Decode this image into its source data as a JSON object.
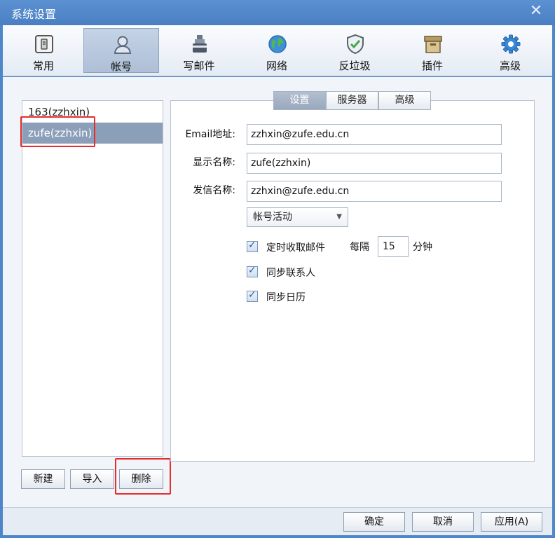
{
  "window": {
    "title": "系统设置",
    "close_glyph": "✕"
  },
  "toolbar": {
    "items": [
      {
        "label": "常用",
        "icon": "switch-icon"
      },
      {
        "label": "帐号",
        "icon": "user-icon"
      },
      {
        "label": "写邮件",
        "icon": "ink-bottle-icon"
      },
      {
        "label": "网络",
        "icon": "globe-icon"
      },
      {
        "label": "反垃圾",
        "icon": "shield-check-icon"
      },
      {
        "label": "插件",
        "icon": "archive-box-icon"
      },
      {
        "label": "高级",
        "icon": "gear-icon"
      }
    ],
    "active_index": 1
  },
  "accounts": {
    "items": [
      "163(zzhxin)",
      "zufe(zzhxin)"
    ],
    "selected_index": 1
  },
  "account_buttons": {
    "new": "新建",
    "import": "导入",
    "delete": "删除"
  },
  "subtabs": {
    "items": [
      "设置",
      "服务器",
      "高级"
    ],
    "active_index": 0
  },
  "form": {
    "email_label": "Email地址:",
    "email_value": "zzhxin@zufe.edu.cn",
    "display_label": "显示名称:",
    "display_value": "zufe(zzhxin)",
    "sender_label": "发信名称:",
    "sender_value": "zzhxin@zufe.edu.cn",
    "status_select": "帐号活动",
    "fetch_label": "定时收取邮件",
    "fetch_checked": true,
    "every_label": "每隔",
    "interval_value": "15",
    "minutes_label": "分钟",
    "sync_contacts_label": "同步联系人",
    "sync_contacts_checked": true,
    "sync_calendar_label": "同步日历",
    "sync_calendar_checked": true
  },
  "footer": {
    "ok": "确定",
    "cancel": "取消",
    "apply": "应用(A)"
  },
  "colors": {
    "title_blue": "#4f86c8",
    "selected_row": "#8c9fb8",
    "highlight_red": "#e52d2d"
  }
}
